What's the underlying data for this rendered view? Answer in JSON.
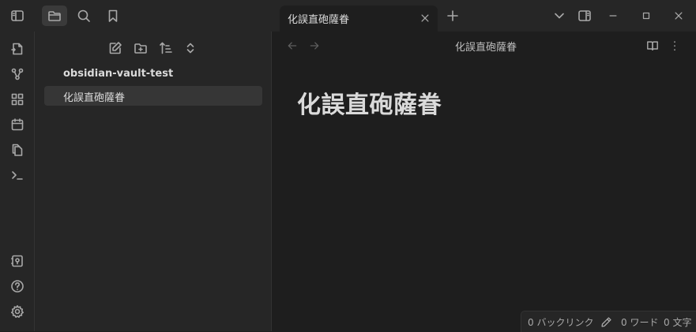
{
  "vault": {
    "name": "obsidian-vault-test"
  },
  "files": [
    {
      "label": "化誤直砲薩眷"
    }
  ],
  "tab": {
    "title": "化誤直砲薩眷"
  },
  "view": {
    "title": "化誤直砲薩眷"
  },
  "document": {
    "heading": "化誤直砲薩眷"
  },
  "status": {
    "backlinks": "0 バックリンク",
    "words": "0 ワード",
    "chars": "0 文字"
  }
}
